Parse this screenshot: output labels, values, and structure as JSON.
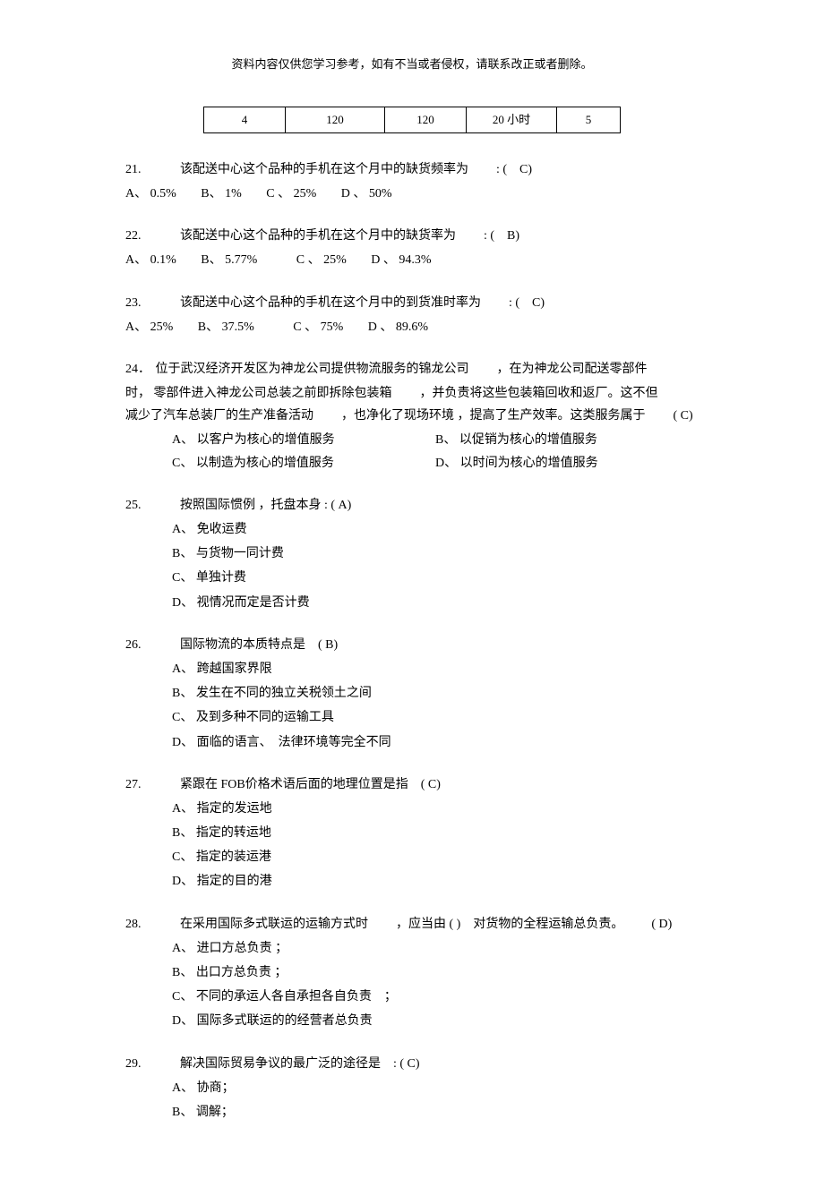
{
  "header_note": "资料内容仅供您学习参考，如有不当或者侵权，请联系改正或者删除。",
  "table_row": {
    "c1": "4",
    "c2": "120",
    "c3": "120",
    "c4": "20 小时",
    "c5": "5"
  },
  "q21": {
    "num": "21.",
    "stem": "该配送中心这个品种的手机在这个月中的缺货频率为",
    "tail": ": (　C)",
    "A": "A、 0.5%",
    "B": "B、 1%",
    "C": "C 、 25%",
    "D": "D 、 50%"
  },
  "q22": {
    "num": "22.",
    "stem": "该配送中心这个品种的手机在这个月中的缺货率为",
    "tail": ": (　B)",
    "A": "A、 0.1%",
    "B": "B、 5.77%",
    "C": "C 、 25%",
    "D": "D 、 94.3%"
  },
  "q23": {
    "num": "23.",
    "stem": "该配送中心这个品种的手机在这个月中的到货准时率为",
    "tail": ": (　C)",
    "A": "A、 25%",
    "B": "B、 37.5%",
    "C": "C 、 75%",
    "D": "D 、 89.6%"
  },
  "q24": {
    "num": "24．",
    "line1a": "位于武汉经济开发区为神龙公司提供物流服务的锦龙公司",
    "line1b": "，在为神龙公司配送零部件",
    "line2a": "时， 零部件进入神龙公司总装之前即拆除包装箱",
    "line2b": "，并负责将这些包装箱回收和返厂。这不但",
    "line3a": "减少了汽车总装厂的生产准备活动",
    "line3b": "，也净化了现场环境 ，提高了生产效率。这类服务属于",
    "line3c": "( C)",
    "A": "A、 以客户为核心的增值服务",
    "B": "B、 以促销为核心的增值服务",
    "C": "C、 以制造为核心的增值服务",
    "D": "D、 以时间为核心的增值服务"
  },
  "q25": {
    "num": "25.",
    "stem": "按照国际惯例 ，托盘本身 : ( A)",
    "A": "A、 免收运费",
    "B": "B、 与货物一同计费",
    "C": "C、 单独计费",
    "D": "D、 视情况而定是否计费"
  },
  "q26": {
    "num": "26.",
    "stem": "国际物流的本质特点是　( B)",
    "A": "A、 跨越国家界限",
    "B": "B、 发生在不同的独立关税领土之间",
    "C": "C、 及到多种不同的运输工具",
    "D": "D、 面临的语言、　法律环境等完全不同"
  },
  "q27": {
    "num": "27.",
    "stem": "紧跟在 FOB价格术语后面的地理位置是指　( C)",
    "A": "A、 指定的发运地",
    "B": "B、 指定的转运地",
    "C": "C、 指定的装运港",
    "D": "D、 指定的目的港"
  },
  "q28": {
    "num": "28.",
    "stem_a": "在采用国际多式联运的运输方式时",
    "stem_b": "，应当由 ( )　对货物的全程运输总负责。",
    "stem_c": "( D)",
    "A": "A、 进口方总负责 ；",
    "B": "B、 出口方总负责 ；",
    "C": "C、 不同的承运人各自承担各自负责　；",
    "D": "D、 国际多式联运的的经营者总负责"
  },
  "q29": {
    "num": "29.",
    "stem": "解决国际贸易争议的最广泛的途径是　: ( C)",
    "A": "A、 协商；",
    "B": "B、 调解；"
  }
}
